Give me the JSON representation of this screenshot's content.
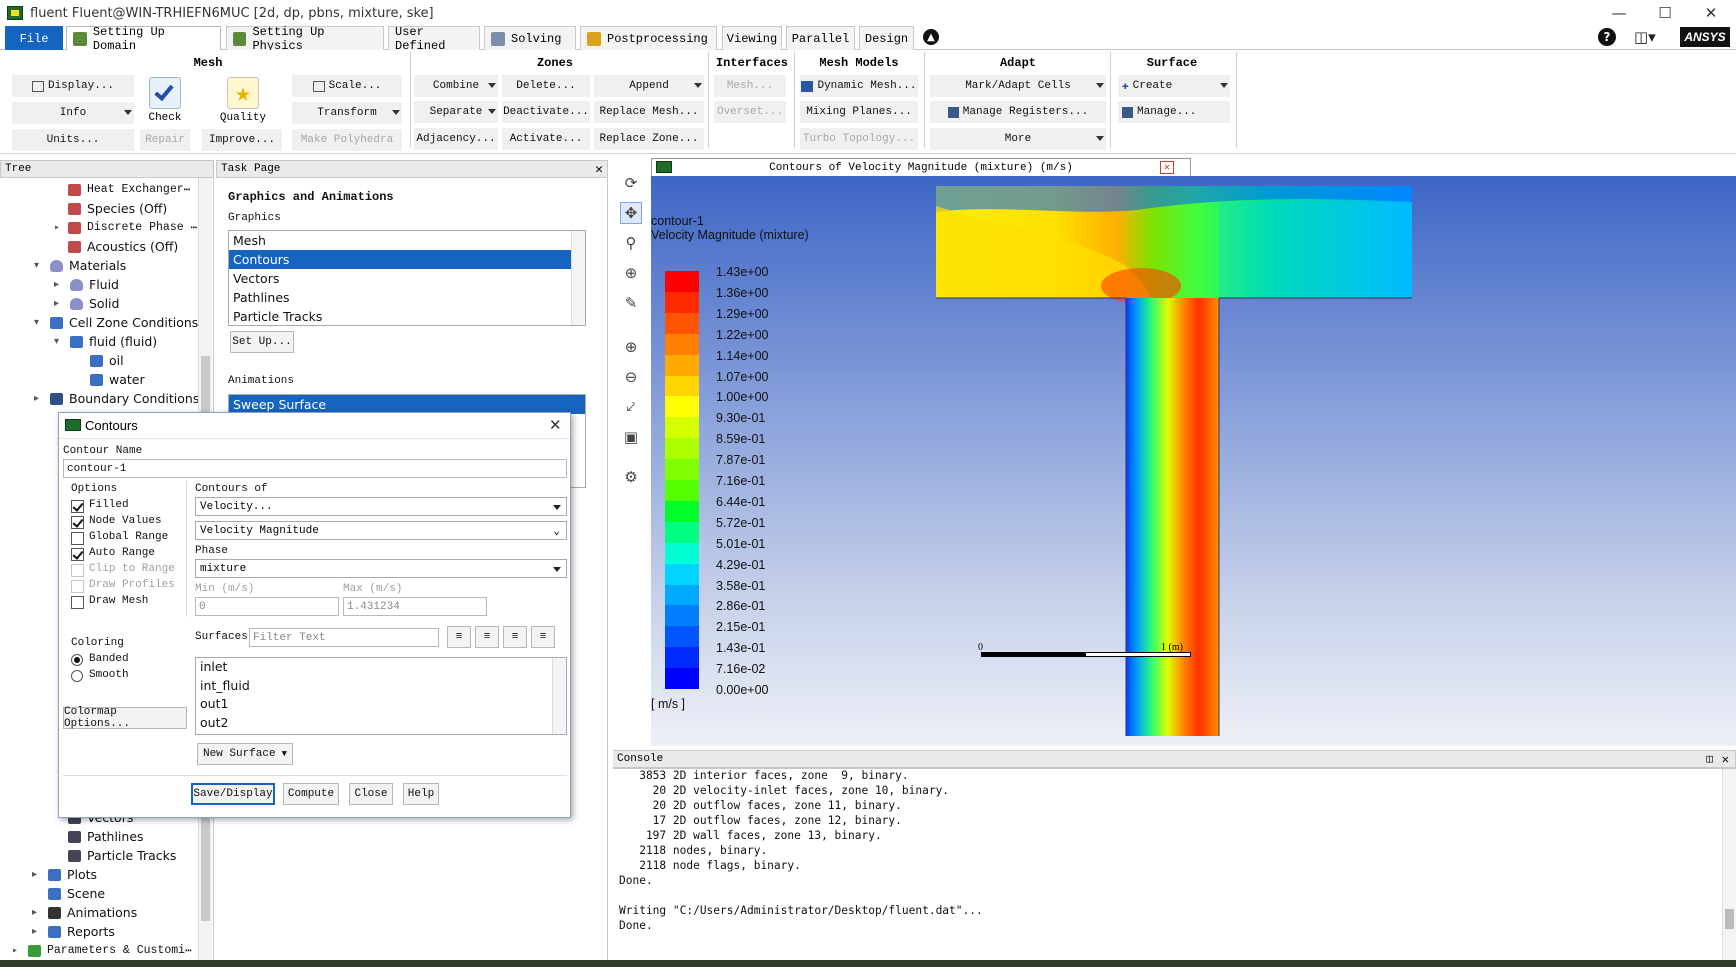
{
  "window": {
    "title": "fluent Fluent@WIN-TRHIEFN6MUC  [2d, dp, pbns, mixture, ske]"
  },
  "menu_tabs": [
    "File",
    "Setting Up Domain",
    "Setting Up Physics",
    "User Defined",
    "Solving",
    "Postprocessing",
    "Viewing",
    "Parallel",
    "Design"
  ],
  "brand": "ANSYS",
  "ribbon": {
    "mesh": {
      "title": "Mesh",
      "display": "Display...",
      "info": "Info",
      "units": "Units...",
      "check": "Check",
      "repair": "Repair",
      "quality": "Quality",
      "improve": "Improve...",
      "scale": "Scale...",
      "transform": "Transform",
      "make_polyhedra": "Make Polyhedra"
    },
    "zones": {
      "title": "Zones",
      "combine": "Combine",
      "delete": "Delete...",
      "append": "Append",
      "separate": "Separate",
      "deactivate": "Deactivate...",
      "replace_mesh": "Replace Mesh...",
      "adjacency": "Adjacency...",
      "activate": "Activate...",
      "replace_zone": "Replace Zone..."
    },
    "interfaces": {
      "title": "Interfaces",
      "mesh": "Mesh...",
      "overset": "Overset..."
    },
    "mesh_models": {
      "title": "Mesh Models",
      "dynamic_mesh": "Dynamic Mesh...",
      "mixing_planes": "Mixing Planes...",
      "turbo_topology": "Turbo Topology..."
    },
    "adapt": {
      "title": "Adapt",
      "mark_adapt": "Mark/Adapt Cells",
      "manage_registers": "Manage Registers...",
      "more": "More"
    },
    "surface": {
      "title": "Surface",
      "create": "Create",
      "manage": "Manage..."
    }
  },
  "tree": {
    "header": "Tree",
    "items": [
      "Heat Exchanger",
      "Species (Off)",
      "Discrete Phase",
      "Acoustics (Off)",
      "Materials",
      "Fluid",
      "Solid",
      "Cell Zone Conditions",
      "fluid (fluid)",
      "oil",
      "water",
      "Boundary Conditions",
      "Vectors",
      "Pathlines",
      "Particle Tracks",
      "Plots",
      "Scene",
      "Animations",
      "Reports",
      "Parameters & Customi"
    ]
  },
  "taskpage": {
    "header": "Task Page",
    "title": "Graphics and Animations",
    "graphics_label": "Graphics",
    "graphics_items": [
      "Mesh",
      "Contours",
      "Vectors",
      "Pathlines",
      "Particle Tracks"
    ],
    "selected": "Contours",
    "setup": "Set Up...",
    "animations_label": "Animations",
    "animation_items": [
      "Sweep Surface"
    ]
  },
  "dialog": {
    "title": "Contours",
    "contour_name_label": "Contour Name",
    "contour_name": "contour-1",
    "options_label": "Options",
    "options": [
      {
        "label": "Filled",
        "checked": true,
        "disabled": false
      },
      {
        "label": "Node Values",
        "checked": true,
        "disabled": false
      },
      {
        "label": "Global Range",
        "checked": false,
        "disabled": false
      },
      {
        "label": "Auto Range",
        "checked": true,
        "disabled": false
      },
      {
        "label": "Clip to Range",
        "checked": false,
        "disabled": true
      },
      {
        "label": "Draw Profiles",
        "checked": false,
        "disabled": true
      },
      {
        "label": "Draw Mesh",
        "checked": false,
        "disabled": false
      }
    ],
    "contours_of_label": "Contours of",
    "contours_of": "Velocity...",
    "contours_sub": "Velocity Magnitude",
    "phase_label": "Phase",
    "phase": "mixture",
    "min_label": "Min (m/s)",
    "max_label": "Max (m/s)",
    "min_value": "0",
    "max_value": "1.431234",
    "coloring_label": "Coloring",
    "banded": "Banded",
    "smooth": "Smooth",
    "colormap": "Colormap Options...",
    "surfaces_label": "Surfaces",
    "filter_placeholder": "Filter Text",
    "surfaces": [
      "inlet",
      "int_fluid",
      "out1",
      "out2"
    ],
    "new_surface": "New Surface",
    "save_display": "Save/Display",
    "compute": "Compute",
    "close": "Close",
    "help": "Help"
  },
  "graphics": {
    "tab_title": "Contours of Velocity Magnitude (mixture)  (m/s)",
    "contour_name": "contour-1",
    "quantity": "Velocity Magnitude (mixture)",
    "legend_values": [
      "1.43e+00",
      "1.36e+00",
      "1.29e+00",
      "1.22e+00",
      "1.14e+00",
      "1.07e+00",
      "1.00e+00",
      "9.30e-01",
      "8.59e-01",
      "7.87e-01",
      "7.16e-01",
      "6.44e-01",
      "5.72e-01",
      "5.01e-01",
      "4.29e-01",
      "3.58e-01",
      "2.86e-01",
      "2.15e-01",
      "1.43e-01",
      "7.16e-02",
      "0.00e+00"
    ],
    "legend_colors": [
      "#ff0000",
      "#ff2a00",
      "#ff5500",
      "#ff8000",
      "#ffaa00",
      "#ffd400",
      "#ffff00",
      "#d4ff00",
      "#aaff00",
      "#80ff00",
      "#55ff00",
      "#00ff2a",
      "#00ff80",
      "#00ffd4",
      "#00d4ff",
      "#00aaff",
      "#0080ff",
      "#0055ff",
      "#002aff",
      "#0000ff"
    ],
    "unit": "[ m/s ]",
    "scale_0": "0",
    "scale_1": "1 (m)"
  },
  "console": {
    "header": "Console",
    "lines": [
      "   3853 2D interior faces, zone  9, binary.",
      "     20 2D velocity-inlet faces, zone 10, binary.",
      "     20 2D outflow faces, zone 11, binary.",
      "     17 2D outflow faces, zone 12, binary.",
      "    197 2D wall faces, zone 13, binary.",
      "   2118 nodes, binary.",
      "   2118 node flags, binary.",
      "Done.",
      "",
      "Writing \"C:/Users/Administrator/Desktop/fluent.dat\"...",
      "Done."
    ]
  }
}
